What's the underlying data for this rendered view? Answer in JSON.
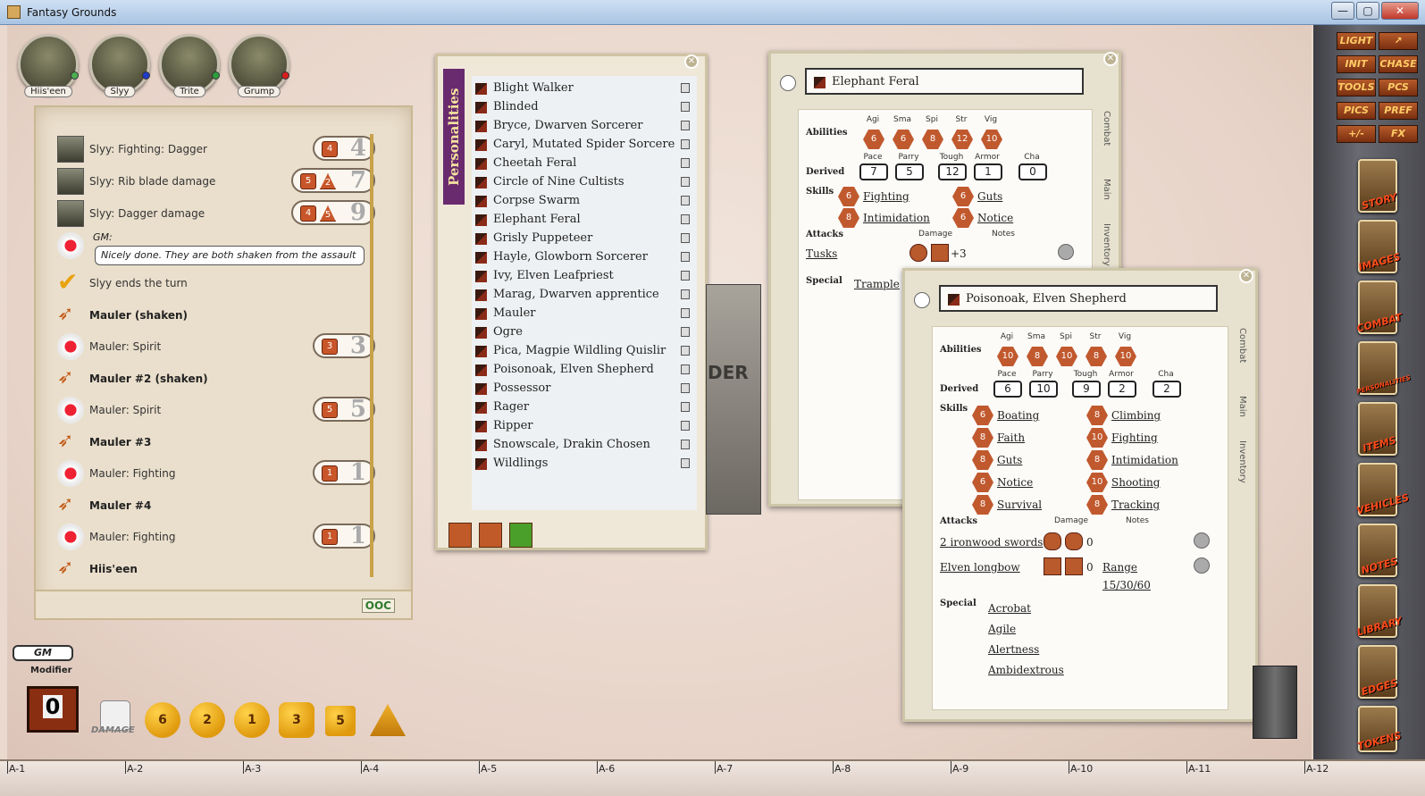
{
  "window": {
    "title": "Fantasy Grounds",
    "min": "—",
    "max": "▢",
    "close": "✕"
  },
  "portraits": [
    {
      "name": "Hiis'een",
      "dot": "#4caf50"
    },
    {
      "name": "Slyy",
      "dot": "#1e3cc8"
    },
    {
      "name": "Trite",
      "dot": "#2e9e3e"
    },
    {
      "name": "Grump",
      "dot": "#d81e1e"
    }
  ],
  "chat": {
    "entries": [
      {
        "text": "Slyy:  Fighting: Dagger",
        "dice": [
          "4"
        ],
        "total": "4",
        "type": "roll"
      },
      {
        "text": "Slyy:  Rib blade damage",
        "dice": [
          "5",
          "2"
        ],
        "total": "7",
        "type": "roll"
      },
      {
        "text": "Slyy:  Dagger damage",
        "dice": [
          "4",
          "5"
        ],
        "total": "9",
        "type": "roll"
      }
    ],
    "gm_label": "GM:",
    "gm_message": "Nicely done. They are both shaken from the assault",
    "turn_text": "Slyy ends the turn",
    "lines": [
      {
        "text": "Mauler (shaken)",
        "bold": true
      },
      {
        "text": "Mauler:  Spirit",
        "dice": [
          "3"
        ],
        "total": "3"
      },
      {
        "text": "Mauler #2 (shaken)",
        "bold": true
      },
      {
        "text": "Mauler:  Spirit",
        "dice": [
          "5"
        ],
        "total": "5"
      },
      {
        "text": "Mauler #3",
        "bold": true
      },
      {
        "text": "Mauler:  Fighting",
        "dice": [
          "1"
        ],
        "total": "1"
      },
      {
        "text": "Mauler #4",
        "bold": true
      },
      {
        "text": "Mauler:  Fighting",
        "dice": [
          "1"
        ],
        "total": "1"
      },
      {
        "text": "Hiis'een",
        "bold": true
      }
    ],
    "ooc": "OOC"
  },
  "personalities": {
    "tab": "Personalities",
    "items": [
      "Blight Walker",
      "Blinded",
      "Bryce, Dwarven Sorcerer",
      "Caryl, Mutated Spider Sorcere",
      "Cheetah Feral",
      "Circle of Nine Cultists",
      "Corpse Swarm",
      "Elephant Feral",
      "Grisly Puppeteer",
      "Hayle, Glowborn Sorcerer",
      "Ivy, Elven Leafpriest",
      "Marag, Dwarven apprentice",
      "Mauler",
      "Ogre",
      "Pica, Magpie Wildling Quislir",
      "Poisonoak, Elven Shepherd",
      "Possessor",
      "Rager",
      "Ripper",
      "Snowscale, Drakin Chosen",
      "Wildlings"
    ]
  },
  "map_text": "DER",
  "sheet1": {
    "name": "Elephant Feral",
    "abilities_label": "Abilities",
    "derived_label": "Derived",
    "skills_label": "Skills",
    "attacks_label": "Attacks",
    "special_label": "Special",
    "damage_hdr": "Damage",
    "notes_hdr": "Notes",
    "ability_hdrs": [
      "Agi",
      "Sma",
      "Spi",
      "Str",
      "Vig"
    ],
    "abilities": [
      "6",
      "6",
      "8",
      "12",
      "10"
    ],
    "derived_hdrs": [
      "Pace",
      "Parry",
      "Tough",
      "Armor",
      "Cha"
    ],
    "derived": [
      "7",
      "5",
      "12",
      "1",
      "0"
    ],
    "skills": [
      {
        "die": "6",
        "name": "Fighting"
      },
      {
        "die": "6",
        "name": "Guts"
      },
      {
        "die": "8",
        "name": "Intimidation"
      },
      {
        "die": "6",
        "name": "Notice"
      }
    ],
    "attack": {
      "name": "Tusks",
      "bonus": "+3"
    },
    "special": "Trample",
    "tabs": [
      "Combat",
      "Main",
      "Inventory"
    ]
  },
  "sheet2": {
    "name": "Poisonoak, Elven Shepherd",
    "abilities_label": "Abilities",
    "derived_label": "Derived",
    "skills_label": "Skills",
    "attacks_label": "Attacks",
    "special_label": "Special",
    "damage_hdr": "Damage",
    "notes_hdr": "Notes",
    "ability_hdrs": [
      "Agi",
      "Sma",
      "Spi",
      "Str",
      "Vig"
    ],
    "abilities": [
      "10",
      "8",
      "10",
      "8",
      "10"
    ],
    "derived_hdrs": [
      "Pace",
      "Parry",
      "Tough",
      "Armor",
      "Cha"
    ],
    "derived": [
      "6",
      "10",
      "9",
      "2",
      "2"
    ],
    "skills": [
      {
        "die": "6",
        "name": "Boating"
      },
      {
        "die": "8",
        "name": "Climbing"
      },
      {
        "die": "8",
        "name": "Faith"
      },
      {
        "die": "10",
        "name": "Fighting"
      },
      {
        "die": "8",
        "name": "Guts"
      },
      {
        "die": "8",
        "name": "Intimidation"
      },
      {
        "die": "6",
        "name": "Notice"
      },
      {
        "die": "10",
        "name": "Shooting"
      },
      {
        "die": "8",
        "name": "Survival"
      },
      {
        "die": "8",
        "name": "Tracking"
      }
    ],
    "attacks": [
      {
        "name": "2 ironwood swords",
        "bonus": "0"
      },
      {
        "name": "Elven longbow",
        "bonus": "0",
        "note": "Range",
        "note2": "15/30/60"
      }
    ],
    "special": [
      "Acrobat",
      "Agile",
      "Alertness",
      "Ambidextrous"
    ],
    "tabs": [
      "Combat",
      "Main",
      "Inventory"
    ]
  },
  "modifier": {
    "gm": "GM",
    "label": "Modifier",
    "value": "0",
    "damage": "DAMAGE"
  },
  "dice": [
    "6",
    "2",
    "1",
    "3",
    "5"
  ],
  "sidebar": {
    "buttons": [
      "LIGHT",
      "",
      "INIT",
      "CHASE",
      "TOOLS",
      "PCS",
      "PICS",
      "PREF",
      "+/-",
      "FX"
    ],
    "cards": [
      "STORY",
      "IMAGES",
      "COMBAT",
      "PERSONALITIES",
      "ITEMS",
      "VEHICLES",
      "NOTES",
      "LIBRARY",
      "EDGES",
      "TOKENS"
    ]
  },
  "grid": [
    "A-1",
    "A-2",
    "A-3",
    "A-4",
    "A-5",
    "A-6",
    "A-7",
    "A-8",
    "A-9",
    "A-10",
    "A-11",
    "A-12"
  ]
}
